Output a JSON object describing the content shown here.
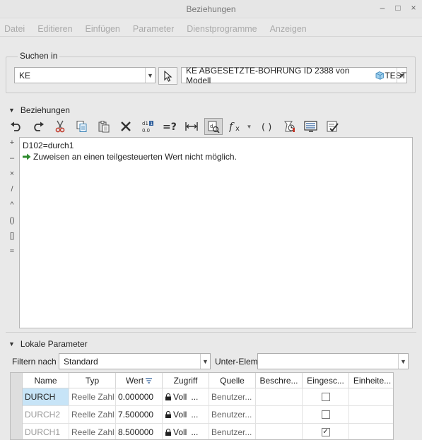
{
  "window": {
    "title": "Beziehungen",
    "controls": [
      "–",
      "□",
      "×"
    ]
  },
  "menu": [
    "Datei",
    "Editieren",
    "Einfügen",
    "Parameter",
    "Dienstprogramme",
    "Anzeigen"
  ],
  "search": {
    "group_label": "Suchen in",
    "type_value": "KE",
    "target_value": "KE ABGESETZTE-BOHRUNG ID 2388 von Modell",
    "target_suffix": "TEST"
  },
  "relations": {
    "section_label": "Beziehungen",
    "toolbar_icons": [
      "undo-icon",
      "redo-icon",
      "cut-icon",
      "copy-icon",
      "paste-icon",
      "delete-icon",
      "sort-icon",
      "evaluate-icon",
      "measure-icon",
      "show-dimension-icon",
      "function-icon",
      "brackets-icon",
      "unit-check-icon",
      "display-icon",
      "verify-icon"
    ],
    "operators": [
      "+",
      "–",
      "×",
      "/",
      "^",
      "()",
      "[]",
      "="
    ],
    "text_line1": "D102=durch1",
    "text_line2": "Zuweisen an einen teilgesteuerten Wert nicht möglich."
  },
  "local_params": {
    "section_label": "Lokale Parameter",
    "filter_label": "Filtern nach",
    "filter_value": "Standard",
    "sub_elem_label": "Unter-Elem",
    "sub_elem_value": "",
    "columns": [
      "Name",
      "Typ",
      "Wert",
      "Zugriff",
      "Quelle",
      "Beschre...",
      "Eingesc...",
      "Einheite..."
    ],
    "rows": [
      {
        "name": "DURCH",
        "typ": "Reelle Zahl",
        "wert": "0.000000",
        "zugriff": "Voll",
        "quelle": "Benutzer...",
        "checked": false
      },
      {
        "name": "DURCH2",
        "typ": "Reelle Zahl",
        "wert": "7.500000",
        "zugriff": "Voll",
        "quelle": "Benutzer...",
        "checked": false
      },
      {
        "name": "DURCH1",
        "typ": "Reelle Zahl",
        "wert": "8.500000",
        "zugriff": "Voll",
        "quelle": "Benutzer...",
        "checked": true
      }
    ]
  }
}
